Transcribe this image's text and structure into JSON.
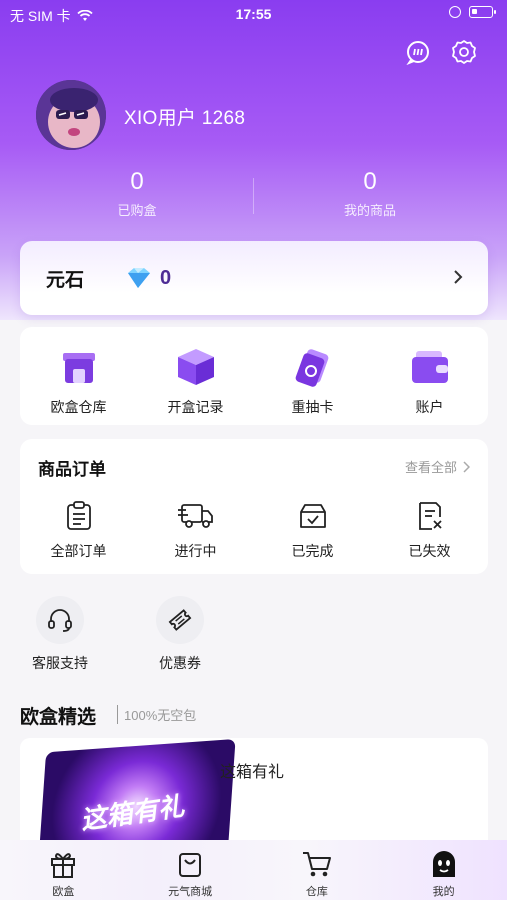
{
  "status_bar": {
    "carrier": "无 SIM 卡",
    "time": "17:55"
  },
  "profile": {
    "username": "XIO用户 1268"
  },
  "stats": [
    {
      "value": "0",
      "label": "已购盒"
    },
    {
      "value": "0",
      "label": "我的商品"
    }
  ],
  "yuanshi": {
    "label": "元石",
    "value": "0"
  },
  "quick_menu": [
    {
      "label": "欧盒仓库",
      "icon": "box-house-icon"
    },
    {
      "label": "开盒记录",
      "icon": "open-box-icon"
    },
    {
      "label": "重抽卡",
      "icon": "redraw-card-icon"
    },
    {
      "label": "账户",
      "icon": "wallet-icon"
    }
  ],
  "orders": {
    "title": "商品订单",
    "view_all": "查看全部",
    "items": [
      {
        "label": "全部订单",
        "icon": "clipboard-icon"
      },
      {
        "label": "进行中",
        "icon": "truck-icon"
      },
      {
        "label": "已完成",
        "icon": "check-box-icon"
      },
      {
        "label": "已失效",
        "icon": "invalid-doc-icon"
      }
    ]
  },
  "services": [
    {
      "label": "客服支持",
      "icon": "headset-icon"
    },
    {
      "label": "优惠券",
      "icon": "coupon-icon"
    }
  ],
  "featured": {
    "title": "欧盒精选",
    "subtitle": "100%无空包",
    "product": {
      "image_text": "这箱有礼",
      "name": "这箱有礼"
    }
  },
  "tabbar": [
    {
      "label": "欧盒",
      "icon": "gift-icon"
    },
    {
      "label": "元气商城",
      "icon": "shopping-bag-icon"
    },
    {
      "label": "仓库",
      "icon": "cart-icon"
    },
    {
      "label": "我的",
      "icon": "ghost-face-icon",
      "active": true
    }
  ],
  "colors": {
    "accent": "#8a3df0",
    "accent_light": "#c9a3f8",
    "yuanshi_value": "#4e2c95"
  }
}
